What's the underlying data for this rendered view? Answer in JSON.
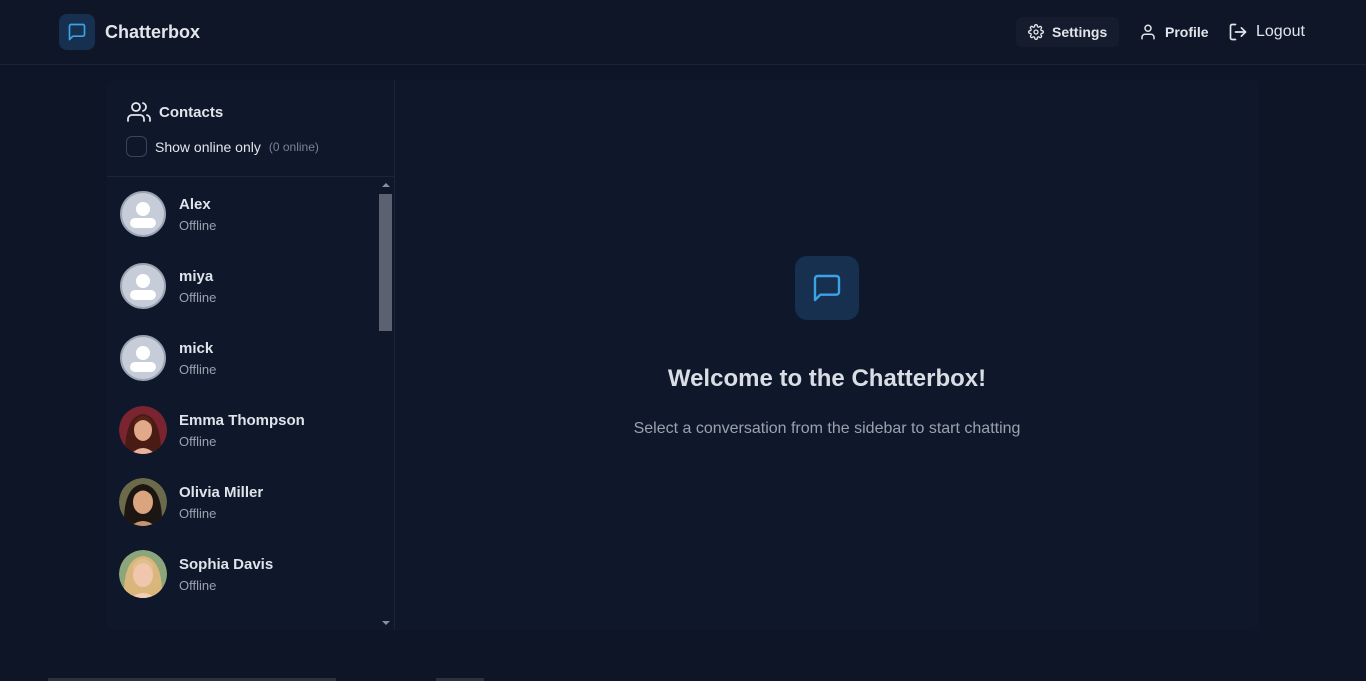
{
  "app": {
    "name": "Chatterbox",
    "icon": "message-square-icon",
    "accent": "#3ba3e6"
  },
  "nav": {
    "settings": {
      "label": "Settings",
      "icon": "gear-icon"
    },
    "profile": {
      "label": "Profile",
      "icon": "user-icon"
    },
    "logout": {
      "label": "Logout",
      "icon": "logout-icon"
    }
  },
  "sidebar": {
    "title": "Contacts",
    "title_icon": "users-icon",
    "filter_label": "Show online only",
    "online_count": "(0 online)",
    "show_online_only": false,
    "contacts": [
      {
        "name": "Alex",
        "status": "Offline",
        "avatar": "default-avatar"
      },
      {
        "name": "miya",
        "status": "Offline",
        "avatar": "default-avatar"
      },
      {
        "name": "mick",
        "status": "Offline",
        "avatar": "default-avatar"
      },
      {
        "name": "Emma Thompson",
        "status": "Offline",
        "avatar": "photo-avatar"
      },
      {
        "name": "Olivia Miller",
        "status": "Offline",
        "avatar": "photo-avatar"
      },
      {
        "name": "Sophia Davis",
        "status": "Offline",
        "avatar": "photo-avatar"
      }
    ]
  },
  "main": {
    "icon": "message-square-icon",
    "title": "Welcome to the Chatterbox!",
    "subtitle": "Select a conversation from the sidebar to start chatting"
  }
}
